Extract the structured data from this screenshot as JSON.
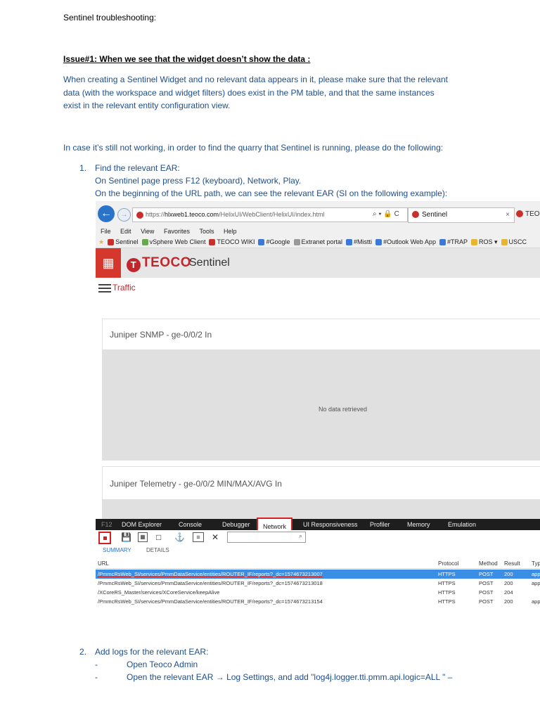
{
  "doc": {
    "title": "Sentinel troubleshooting:",
    "issue_heading": "Issue#1: When we see that the widget doesn’t show the data :",
    "para1": [
      "When creating a Sentinel Widget and no relevant data appears in it, please make sure that the relevant",
      "data (with the workspace and widget filters) does exist in the PM table, and that the same instances",
      "exist in the relevant entity configuration view."
    ],
    "para2": "In case it’s still not working, in order to find the quarry that Sentinel is running, please do the following:",
    "step1": {
      "num": "1.",
      "lines": [
        "Find the relevant EAR:",
        "On Sentinel page press F12 (keyboard), Network, Play.",
        "On the beginning of the URL path, we can see the relevant EAR (SI on the following example):"
      ]
    },
    "step2": {
      "num": "2.",
      "title": "Add logs for the relevant EAR:",
      "bullets": [
        {
          "dash": "-",
          "text": "Open Teoco Admin"
        },
        {
          "dash": "-",
          "text": "Open the relevant EAR → Log Settings, and add \"log4j.logger.tti.pmm.api.logic=ALL \" –"
        }
      ]
    }
  },
  "screenshot": {
    "browser": {
      "url_prefix": "https://",
      "url_domain": "hlxweb1.teoco.com",
      "url_path": "/HelixUI/WebClient/HelixUI/index.html",
      "url_tools": "⌕ ▾ 🔒 C",
      "active_tab": "Sentinel",
      "active_tab_close": "×",
      "other_tab": "TEOCO"
    },
    "menu": [
      "File",
      "Edit",
      "View",
      "Favorites",
      "Tools",
      "Help"
    ],
    "favorites": [
      {
        "label": "Sentinel",
        "color": "#c9302c"
      },
      {
        "label": "vSphere Web Client",
        "color": "#6aa84f"
      },
      {
        "label": "TEOCO WIKI",
        "color": "#c9302c"
      },
      {
        "label": "#Google",
        "color": "#3c78d8"
      },
      {
        "label": "Extranet portal",
        "color": "#999999"
      },
      {
        "label": "#Mistti",
        "color": "#3c78d8"
      },
      {
        "label": "#Outlook Web App",
        "color": "#3c78d8"
      },
      {
        "label": "#TRAP",
        "color": "#3c78d8"
      },
      {
        "label": "ROS ▾",
        "color": "#e8b533"
      },
      {
        "label": "USCC",
        "color": "#e8b533"
      }
    ],
    "app": {
      "logo_text": "TEOCO",
      "app_name": "Sentinel",
      "nav_label": "Traffic",
      "widget1_title": "Juniper SNMP - ge-0/0/2 In",
      "widget1_empty": "No data retrieved",
      "widget2_title": "Juniper Telemetry - ge-0/0/2 MIN/MAX/AVG In"
    },
    "devtools": {
      "tabs": [
        "F12",
        "DOM Explorer",
        "Console",
        "Debugger",
        "Network",
        "UI Responsiveness",
        "Profiler",
        "Memory",
        "Emulation"
      ],
      "search_icon": "⌕",
      "subtabs": [
        "SUMMARY",
        "DETAILS"
      ],
      "columns": [
        "URL",
        "Protocol",
        "Method",
        "Result",
        "Typ"
      ],
      "rows": [
        {
          "url": "/PmmcRsWeb_SI/services/PmmDataService/entities/ROUTER_IF/reports?_dc=1574673213007",
          "protocol": "HTTPS",
          "method": "POST",
          "result": "200",
          "type": "app"
        },
        {
          "url": "/PmmcRsWeb_SI/services/PmmDataService/entities/ROUTER_IF/reports?_dc=1574673213018",
          "protocol": "HTTPS",
          "method": "POST",
          "result": "200",
          "type": "app"
        },
        {
          "url": "/XCoreRS_Master/services/XCoreService/keepAlive",
          "protocol": "HTTPS",
          "method": "POST",
          "result": "204",
          "type": ""
        },
        {
          "url": "/PmmcRsWeb_SI/services/PmmDataService/entities/ROUTER_IF/reports?_dc=1574673213154",
          "protocol": "HTTPS",
          "method": "POST",
          "result": "200",
          "type": "app"
        }
      ]
    }
  }
}
